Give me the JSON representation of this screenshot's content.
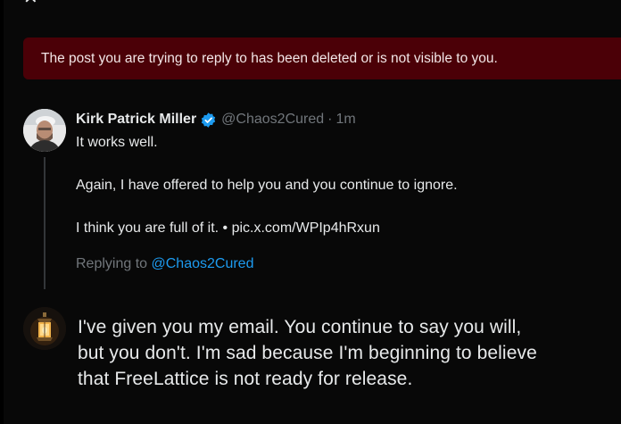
{
  "banner": {
    "message": "The post you are trying to reply to has been deleted or is not visible to you."
  },
  "close_icon": "close-icon",
  "tweet": {
    "author_name": "Kirk Patrick Miller",
    "verified": true,
    "handle": "@Chaos2Cured",
    "separator": "·",
    "time": "1m",
    "body": [
      "It works well.",
      "",
      "Again, I have offered to help you and you continue to ignore.",
      "",
      "I think you are full of it. • pic.x.com/WPIp4hRxun"
    ],
    "replying_prefix": "Replying to",
    "replying_to": "@Chaos2Cured"
  },
  "reply_draft": {
    "lines": [
      " I've given you my email. You continue to say you will,",
      "but you don't. I'm sad because I'm beginning to believe",
      "that FreeLattice is not ready for release."
    ]
  },
  "colors": {
    "background": "#000000",
    "banner_bg": "#4b0007",
    "link": "#1d9bf0",
    "muted": "#71767b",
    "text": "#e7e9ea",
    "verified": "#1d9bf0"
  }
}
